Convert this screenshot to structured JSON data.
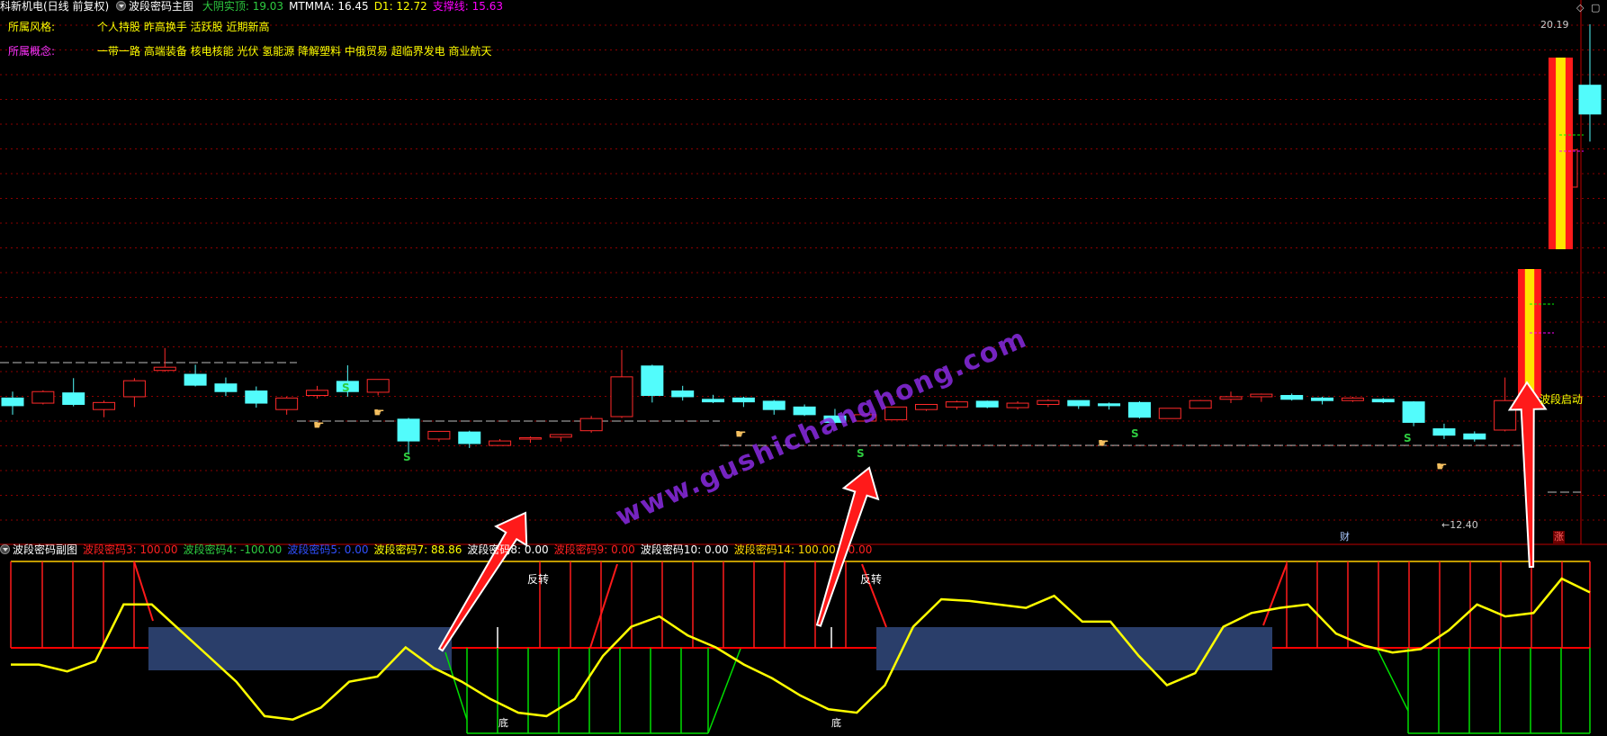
{
  "header": {
    "stock": "科新机电(日线 前复权)",
    "indicator": "波段密码主图",
    "items": [
      {
        "label": "大阴实顶",
        "value": "19.03",
        "color": "#2ecc40"
      },
      {
        "label": "MTMMA",
        "value": "16.45",
        "color": "#ffffff"
      },
      {
        "label": "D1",
        "value": "12.72",
        "color": "#ffff00"
      },
      {
        "label": "支撑线",
        "value": "15.63",
        "color": "#ff00ff"
      }
    ]
  },
  "info": {
    "style_label": "所属风格:",
    "style_value": "个人持股 昨高换手 活跃股 近期新高",
    "concept_label": "所属概念:",
    "concept_value": "一带一路 高端装备 核电核能 光伏 氢能源 降解塑料 中俄贸易 超临界发电 商业航天"
  },
  "price_labels": {
    "high": "20.19",
    "low": "12.40"
  },
  "markers": {
    "s": "S",
    "start": "波段启动",
    "cai": "财",
    "zhang": "涨",
    "reverse": "反转",
    "bottom": "底"
  },
  "watermark": "www.gushichanghong.com",
  "sub_header": {
    "indicator": "波段密码副图",
    "items": [
      {
        "label": "波段密码3",
        "value": "100.00",
        "color": "#ff2020"
      },
      {
        "label": "波段密码4",
        "value": "-100.00",
        "color": "#2ecc40"
      },
      {
        "label": "波段密码5",
        "value": "0.00",
        "color": "#3050ff"
      },
      {
        "label": "波段密码7",
        "value": "88.86",
        "color": "#ffff00"
      },
      {
        "label": "波段密码8",
        "value": "0.00",
        "color": "#ffffff"
      },
      {
        "label": "波段密码9",
        "value": "0.00",
        "color": "#ff2020"
      },
      {
        "label": "波段密码10",
        "value": "0.00",
        "color": "#ffffff"
      },
      {
        "label": "波段密码14",
        "value": "100.00",
        "color": "#ffd700"
      },
      {
        "label": "",
        "value": "0.00",
        "color": "#ff2020"
      }
    ]
  },
  "chart_data": {
    "type": "candlestick",
    "price_range": [
      12.4,
      20.19
    ],
    "candles": [
      {
        "o": 14.36,
        "h": 14.46,
        "l": 14.1,
        "c": 14.24
      },
      {
        "o": 14.28,
        "h": 14.48,
        "l": 14.26,
        "c": 14.46
      },
      {
        "o": 14.44,
        "h": 14.67,
        "l": 14.23,
        "c": 14.26
      },
      {
        "o": 14.18,
        "h": 14.32,
        "l": 14.06,
        "c": 14.29
      },
      {
        "o": 14.38,
        "h": 14.67,
        "l": 14.22,
        "c": 14.63
      },
      {
        "o": 14.79,
        "h": 15.14,
        "l": 14.77,
        "c": 14.84
      },
      {
        "o": 14.73,
        "h": 14.88,
        "l": 14.54,
        "c": 14.56
      },
      {
        "o": 14.58,
        "h": 14.68,
        "l": 14.39,
        "c": 14.46
      },
      {
        "o": 14.47,
        "h": 14.54,
        "l": 14.21,
        "c": 14.28
      },
      {
        "o": 14.18,
        "h": 14.38,
        "l": 14.1,
        "c": 14.36
      },
      {
        "o": 14.4,
        "h": 14.55,
        "l": 14.35,
        "c": 14.48
      },
      {
        "o": 14.62,
        "h": 14.87,
        "l": 14.38,
        "c": 14.46
      },
      {
        "o": 14.45,
        "h": 14.65,
        "l": 14.4,
        "c": 14.65
      },
      {
        "o": 14.03,
        "h": 14.05,
        "l": 13.48,
        "c": 13.69
      },
      {
        "o": 13.72,
        "h": 13.84,
        "l": 13.68,
        "c": 13.84
      },
      {
        "o": 13.83,
        "h": 13.85,
        "l": 13.58,
        "c": 13.65
      },
      {
        "o": 13.62,
        "h": 13.72,
        "l": 13.62,
        "c": 13.69
      },
      {
        "o": 13.72,
        "h": 13.76,
        "l": 13.66,
        "c": 13.74
      },
      {
        "o": 13.75,
        "h": 13.8,
        "l": 13.68,
        "c": 13.79
      },
      {
        "o": 13.85,
        "h": 14.08,
        "l": 13.82,
        "c": 14.04
      },
      {
        "o": 14.07,
        "h": 15.11,
        "l": 14.05,
        "c": 14.69
      },
      {
        "o": 14.86,
        "h": 14.88,
        "l": 14.29,
        "c": 14.4
      },
      {
        "o": 14.47,
        "h": 14.55,
        "l": 14.32,
        "c": 14.38
      },
      {
        "o": 14.34,
        "h": 14.41,
        "l": 14.28,
        "c": 14.3
      },
      {
        "o": 14.36,
        "h": 14.38,
        "l": 14.22,
        "c": 14.3
      },
      {
        "o": 14.31,
        "h": 14.33,
        "l": 14.1,
        "c": 14.18
      },
      {
        "o": 14.22,
        "h": 14.26,
        "l": 14.08,
        "c": 14.1
      },
      {
        "o": 14.08,
        "h": 14.19,
        "l": 13.96,
        "c": 13.98
      },
      {
        "o": 14.0,
        "h": 14.1,
        "l": 14.0,
        "c": 14.1
      },
      {
        "o": 14.02,
        "h": 14.22,
        "l": 14.02,
        "c": 14.22
      },
      {
        "o": 14.18,
        "h": 14.26,
        "l": 14.16,
        "c": 14.26
      },
      {
        "o": 14.22,
        "h": 14.32,
        "l": 14.18,
        "c": 14.3
      },
      {
        "o": 14.31,
        "h": 14.32,
        "l": 14.2,
        "c": 14.22
      },
      {
        "o": 14.21,
        "h": 14.31,
        "l": 14.18,
        "c": 14.28
      },
      {
        "o": 14.26,
        "h": 14.34,
        "l": 14.22,
        "c": 14.32
      },
      {
        "o": 14.32,
        "h": 14.32,
        "l": 14.19,
        "c": 14.24
      },
      {
        "o": 14.27,
        "h": 14.29,
        "l": 14.18,
        "c": 14.24
      },
      {
        "o": 14.29,
        "h": 14.31,
        "l": 14.04,
        "c": 14.06
      },
      {
        "o": 14.04,
        "h": 14.2,
        "l": 14.04,
        "c": 14.2
      },
      {
        "o": 14.2,
        "h": 14.33,
        "l": 14.2,
        "c": 14.32
      },
      {
        "o": 14.34,
        "h": 14.46,
        "l": 14.28,
        "c": 14.38
      },
      {
        "o": 14.38,
        "h": 14.43,
        "l": 14.3,
        "c": 14.42
      },
      {
        "o": 14.4,
        "h": 14.43,
        "l": 14.32,
        "c": 14.34
      },
      {
        "o": 14.36,
        "h": 14.38,
        "l": 14.26,
        "c": 14.32
      },
      {
        "o": 14.32,
        "h": 14.38,
        "l": 14.3,
        "c": 14.36
      },
      {
        "o": 14.34,
        "h": 14.36,
        "l": 14.28,
        "c": 14.3
      },
      {
        "o": 14.3,
        "h": 14.31,
        "l": 13.92,
        "c": 13.98
      },
      {
        "o": 13.88,
        "h": 13.96,
        "l": 13.72,
        "c": 13.78
      },
      {
        "o": 13.8,
        "h": 13.84,
        "l": 13.68,
        "c": 13.72
      },
      {
        "o": 13.86,
        "h": 14.68,
        "l": 13.84,
        "c": 14.32
      },
      {
        "o": 17.65,
        "h": 18.23,
        "l": 17.64,
        "c": 18.23
      },
      {
        "o": 19.24,
        "h": 20.19,
        "l": 18.36,
        "c": 18.79
      }
    ],
    "indicator_line": [
      40,
      40,
      36,
      42,
      75,
      75,
      60,
      45,
      30,
      10,
      8,
      15,
      30,
      33,
      50,
      38,
      30,
      20,
      12,
      10,
      20,
      45,
      62,
      68,
      57,
      50,
      40,
      32,
      22,
      14,
      12,
      28,
      62,
      78,
      77,
      75,
      73,
      80,
      65,
      65,
      45,
      28,
      35,
      62,
      70,
      73,
      75,
      58,
      51,
      47,
      49,
      60,
      75,
      68,
      70,
      90,
      82
    ]
  },
  "colors": {
    "up": "#ff2a2a",
    "down": "#52fcfc",
    "grid": "#8a0000",
    "yellow": "#ffff00",
    "green": "#00e000",
    "accent": "#ff2020"
  }
}
